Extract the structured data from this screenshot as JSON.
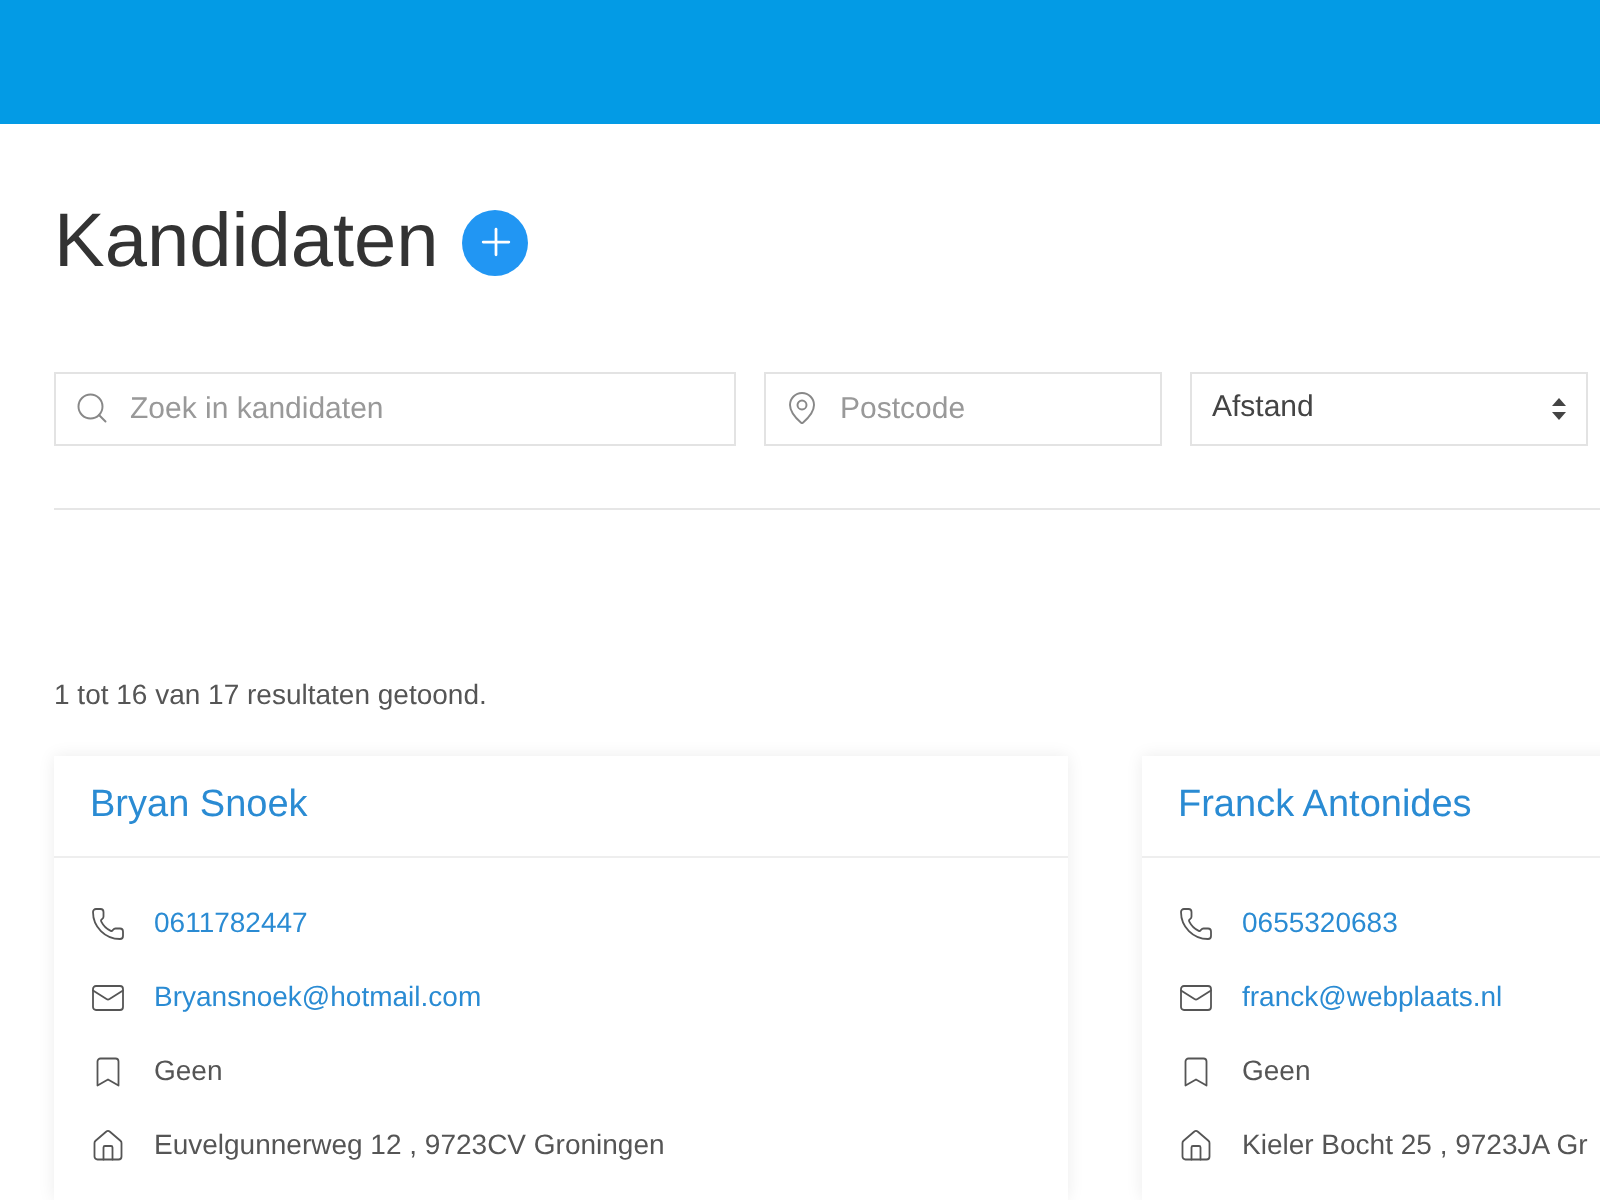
{
  "page": {
    "title": "Kandidaten"
  },
  "filters": {
    "search": {
      "placeholder": "Zoek in kandidaten"
    },
    "postcode": {
      "placeholder": "Postcode"
    },
    "distance": {
      "value": "Afstand"
    }
  },
  "results_summary": "1 tot 16 van 17 resultaten getoond.",
  "candidates": [
    {
      "name": "Bryan Snoek",
      "phone": "0611782447",
      "email": "Bryansnoek@hotmail.com",
      "tag": "Geen",
      "address": "Euvelgunnerweg 12 , 9723CV Groningen"
    },
    {
      "name": "Franck Antonides",
      "phone": "0655320683",
      "email": "franck@webplaats.nl",
      "tag": "Geen",
      "address": "Kieler Bocht 25 , 9723JA Gr"
    }
  ]
}
